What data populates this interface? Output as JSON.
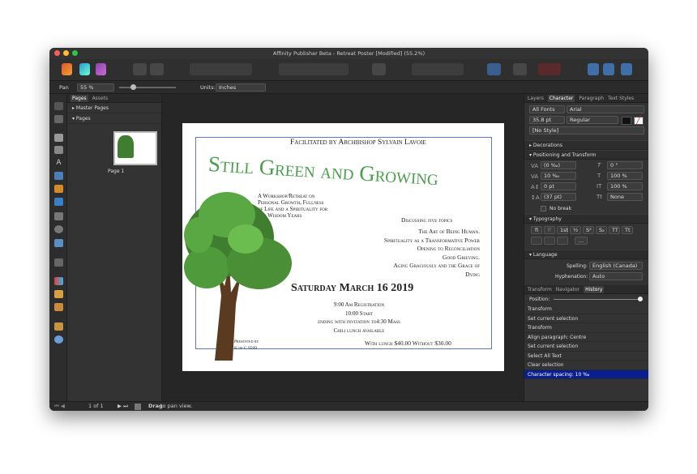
{
  "window": {
    "title": "Affinity Publisher Beta - Retreat Poster [Modified] (55.2%)"
  },
  "context_toolbar": {
    "tool": "Pan",
    "zoom": "55 %",
    "units_label": "Units:",
    "units": "Inches"
  },
  "pages_panel": {
    "tabs": [
      "Pages",
      "Assets"
    ],
    "master_pages": "Master Pages",
    "pages": "Pages",
    "page_label": "Page 1"
  },
  "status_bar": {
    "page": "1 of 1",
    "hint_bold": "Drag",
    "hint": "to pan view."
  },
  "right_panel": {
    "top_tabs": [
      "Layers",
      "Character",
      "Paragraph",
      "Text Styles"
    ],
    "font_collection": "All Fonts",
    "font_family": "Arial",
    "font_size": "35.8 pt",
    "font_style": "Regular",
    "char_style": "[No Style]",
    "sections": {
      "decorations": "Decorations",
      "positioning": "Positioning and Transform",
      "typography": "Typography",
      "language": "Language"
    },
    "positioning": {
      "kern": "(0 ‰)",
      "tracking": "10 ‰",
      "baseline": "0 pt",
      "leading": "(37 pt)",
      "skew": "0 °",
      "scale_h": "100 %",
      "scale_v": "100 %",
      "case": "None",
      "no_break": "No break"
    },
    "typography_buttons": [
      "fi",
      "ﬀ",
      "1st",
      "½",
      "S²",
      "S₂",
      "TT",
      "Tt"
    ],
    "language": {
      "spelling_label": "Spelling:",
      "spelling": "English (Canada)",
      "hyphenation_label": "Hyphenation:",
      "hyphenation": "Auto"
    },
    "bottom_tabs": [
      "Transform",
      "Navigator",
      "History"
    ],
    "history_position": "Position:",
    "history": [
      "Transform",
      "Set current selection",
      "Transform",
      "Align paragraph: Centre",
      "Set current selection",
      "Select All Text",
      "Clear selection",
      "Character spacing: 10 ‰"
    ]
  },
  "poster": {
    "facilitator": "Facilitated by Archbishop Sylvain Lavoie",
    "title": "Still Green and Growing",
    "intro": [
      "A Workshop/Retreat on",
      "Personal Growth, Fullness",
      "of Life and a Spirituality for",
      "our Wisdom Years"
    ],
    "topics_header": "Discussing five topics",
    "topics": [
      "The Art of Being Human.",
      "Spirituality as a Transformative Power",
      "Opening to Reconciliation",
      "Good Grieving.",
      "Aging Graciously and the Grace of",
      "Dying"
    ],
    "date": "Saturday March 16 2019",
    "schedule": [
      "9:00 Am Registration",
      "10:00 Start",
      "ending with invitation to4:30 Mass",
      "Chili lunch available"
    ],
    "presented": [
      "Presented by",
      "K of C 9599"
    ],
    "price": "With lunch $40.00 Without $30.00"
  },
  "colors": {
    "accent": "#3b8a3e",
    "selection": "#0a1f8f",
    "title_green": "#4a9e4c"
  }
}
